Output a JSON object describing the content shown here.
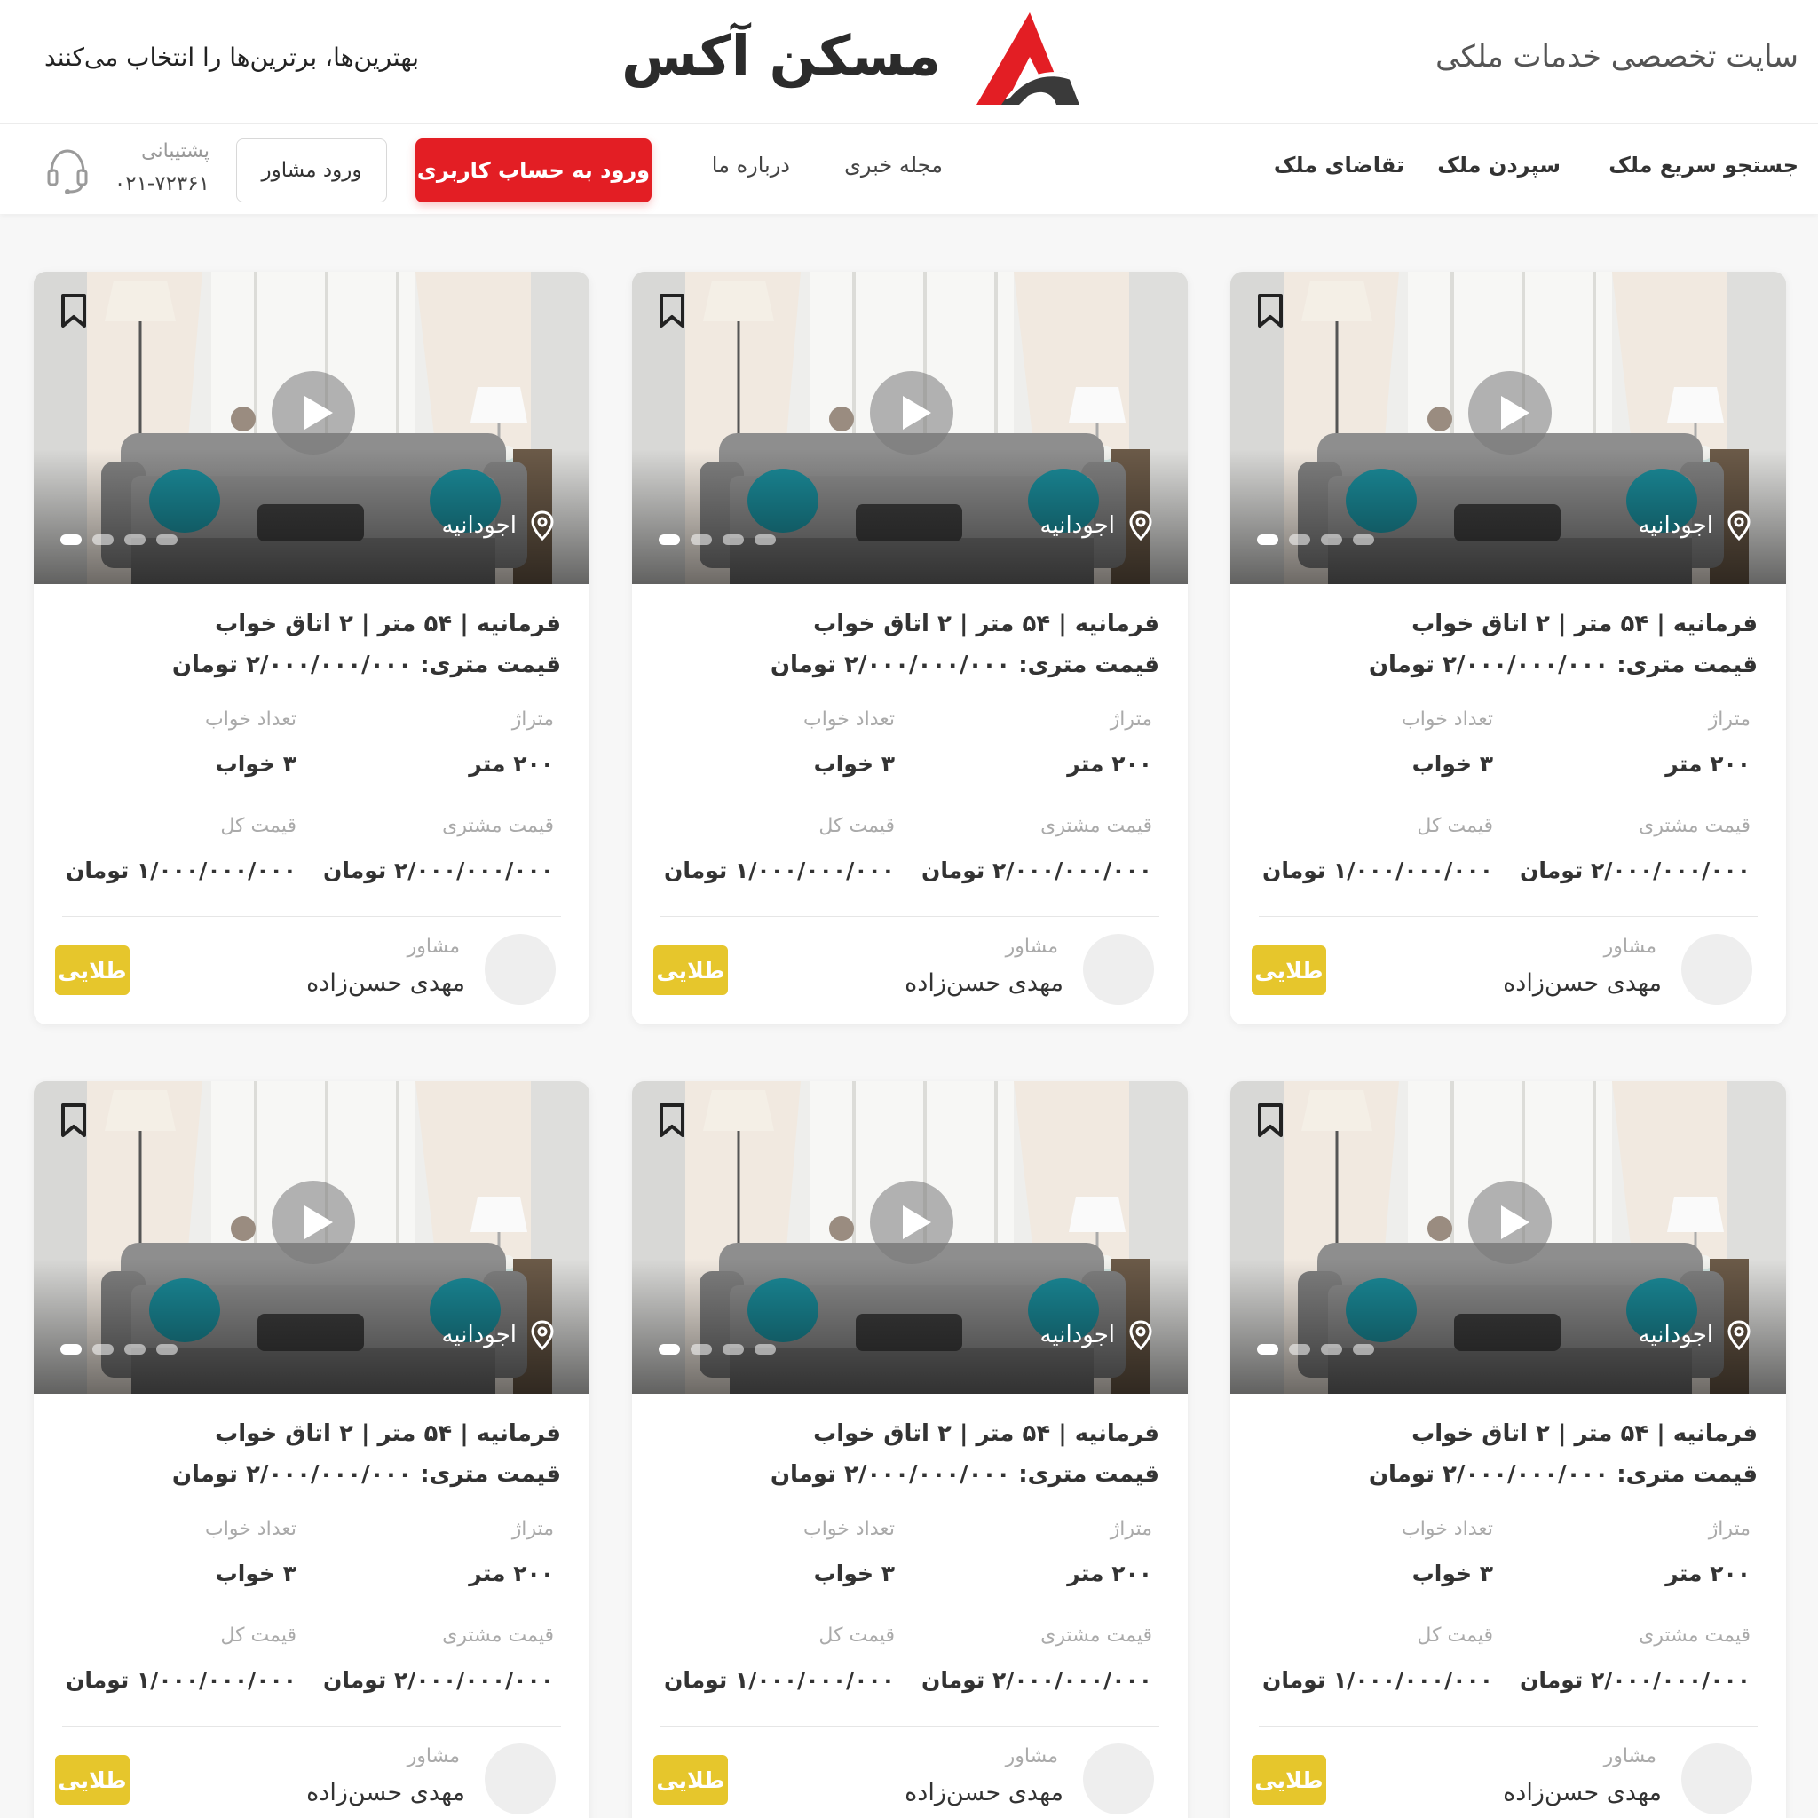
{
  "header": {
    "tagline": "سایت تخصصی خدمات ملکی",
    "logo_text": "مسکن آکس",
    "slogan": "بهترین‌ها، برترین‌ها را انتخاب می‌کنند",
    "brand_color": "#e31e24"
  },
  "nav": {
    "items": [
      {
        "label": "جستجو سریع ملک"
      },
      {
        "label": "سپردن ملک"
      },
      {
        "label": "تقاضای ملک"
      },
      {
        "label": "مجله خبری"
      },
      {
        "label": "درباره ما"
      }
    ],
    "login_button": "ورود به حساب کاربری",
    "advisor_button": "ورود مشاور",
    "support_label": "پشتیبانی",
    "support_phone": "۰۲۱-۷۲۳۶۱"
  },
  "listing": {
    "columns_per_row": 3,
    "cards": [
      {
        "location": "اجودانیه",
        "title": "فرمانیه  |  ۵۴ متر  |  ۲ اتاق خواب",
        "meter_price": "قیمت متری: ۲/۰۰۰/۰۰۰/۰۰۰ تومان",
        "area_label": "متراژ",
        "area_value": "۲۰۰ متر",
        "bedrooms_label": "تعداد خواب",
        "bedrooms_value": "۳ خواب",
        "customer_price_label": "قیمت مشتری",
        "customer_price_value": "۲/۰۰۰/۰۰۰/۰۰۰ تومان",
        "total_price_label": "قیمت کل",
        "total_price_value": "۱/۰۰۰/۰۰۰/۰۰۰ تومان",
        "advisor_label": "مشاور",
        "advisor_name": "مهدی حسن‌زاده",
        "badge": "طلایی",
        "slides": 4,
        "active_slide": 1
      },
      {
        "location": "اجودانیه",
        "title": "فرمانیه  |  ۵۴ متر  |  ۲ اتاق خواب",
        "meter_price": "قیمت متری: ۲/۰۰۰/۰۰۰/۰۰۰ تومان",
        "area_label": "متراژ",
        "area_value": "۲۰۰ متر",
        "bedrooms_label": "تعداد خواب",
        "bedrooms_value": "۳ خواب",
        "customer_price_label": "قیمت مشتری",
        "customer_price_value": "۲/۰۰۰/۰۰۰/۰۰۰ تومان",
        "total_price_label": "قیمت کل",
        "total_price_value": "۱/۰۰۰/۰۰۰/۰۰۰ تومان",
        "advisor_label": "مشاور",
        "advisor_name": "مهدی حسن‌زاده",
        "badge": "طلایی",
        "slides": 4,
        "active_slide": 1
      },
      {
        "location": "اجودانیه",
        "title": "فرمانیه  |  ۵۴ متر  |  ۲ اتاق خواب",
        "meter_price": "قیمت متری: ۲/۰۰۰/۰۰۰/۰۰۰ تومان",
        "area_label": "متراژ",
        "area_value": "۲۰۰ متر",
        "bedrooms_label": "تعداد خواب",
        "bedrooms_value": "۳ خواب",
        "customer_price_label": "قیمت مشتری",
        "customer_price_value": "۲/۰۰۰/۰۰۰/۰۰۰ تومان",
        "total_price_label": "قیمت کل",
        "total_price_value": "۱/۰۰۰/۰۰۰/۰۰۰ تومان",
        "advisor_label": "مشاور",
        "advisor_name": "مهدی حسن‌زاده",
        "badge": "طلایی",
        "slides": 4,
        "active_slide": 1
      },
      {
        "location": "اجودانیه",
        "title": "فرمانیه  |  ۵۴ متر  |  ۲ اتاق خواب",
        "meter_price": "قیمت متری: ۲/۰۰۰/۰۰۰/۰۰۰ تومان",
        "area_label": "متراژ",
        "area_value": "۲۰۰ متر",
        "bedrooms_label": "تعداد خواب",
        "bedrooms_value": "۳ خواب",
        "customer_price_label": "قیمت مشتری",
        "customer_price_value": "۲/۰۰۰/۰۰۰/۰۰۰ تومان",
        "total_price_label": "قیمت کل",
        "total_price_value": "۱/۰۰۰/۰۰۰/۰۰۰ تومان",
        "advisor_label": "مشاور",
        "advisor_name": "مهدی حسن‌زاده",
        "badge": "طلایی",
        "slides": 4,
        "active_slide": 1
      },
      {
        "location": "اجودانیه",
        "title": "فرمانیه  |  ۵۴ متر  |  ۲ اتاق خواب",
        "meter_price": "قیمت متری: ۲/۰۰۰/۰۰۰/۰۰۰ تومان",
        "area_label": "متراژ",
        "area_value": "۲۰۰ متر",
        "bedrooms_label": "تعداد خواب",
        "bedrooms_value": "۳ خواب",
        "customer_price_label": "قیمت مشتری",
        "customer_price_value": "۲/۰۰۰/۰۰۰/۰۰۰ تومان",
        "total_price_label": "قیمت کل",
        "total_price_value": "۱/۰۰۰/۰۰۰/۰۰۰ تومان",
        "advisor_label": "مشاور",
        "advisor_name": "مهدی حسن‌زاده",
        "badge": "طلایی",
        "slides": 4,
        "active_slide": 1
      },
      {
        "location": "اجودانیه",
        "title": "فرمانیه  |  ۵۴ متر  |  ۲ اتاق خواب",
        "meter_price": "قیمت متری: ۲/۰۰۰/۰۰۰/۰۰۰ تومان",
        "area_label": "متراژ",
        "area_value": "۲۰۰ متر",
        "bedrooms_label": "تعداد خواب",
        "bedrooms_value": "۳ خواب",
        "customer_price_label": "قیمت مشتری",
        "customer_price_value": "۲/۰۰۰/۰۰۰/۰۰۰ تومان",
        "total_price_label": "قیمت کل",
        "total_price_value": "۱/۰۰۰/۰۰۰/۰۰۰ تومان",
        "advisor_label": "مشاور",
        "advisor_name": "مهدی حسن‌زاده",
        "badge": "طلایی",
        "slides": 4,
        "active_slide": 1
      }
    ]
  },
  "colors": {
    "primary_red": "#e31e24",
    "gold_badge": "#e6c62c",
    "page_bg": "#f7f7f7"
  }
}
